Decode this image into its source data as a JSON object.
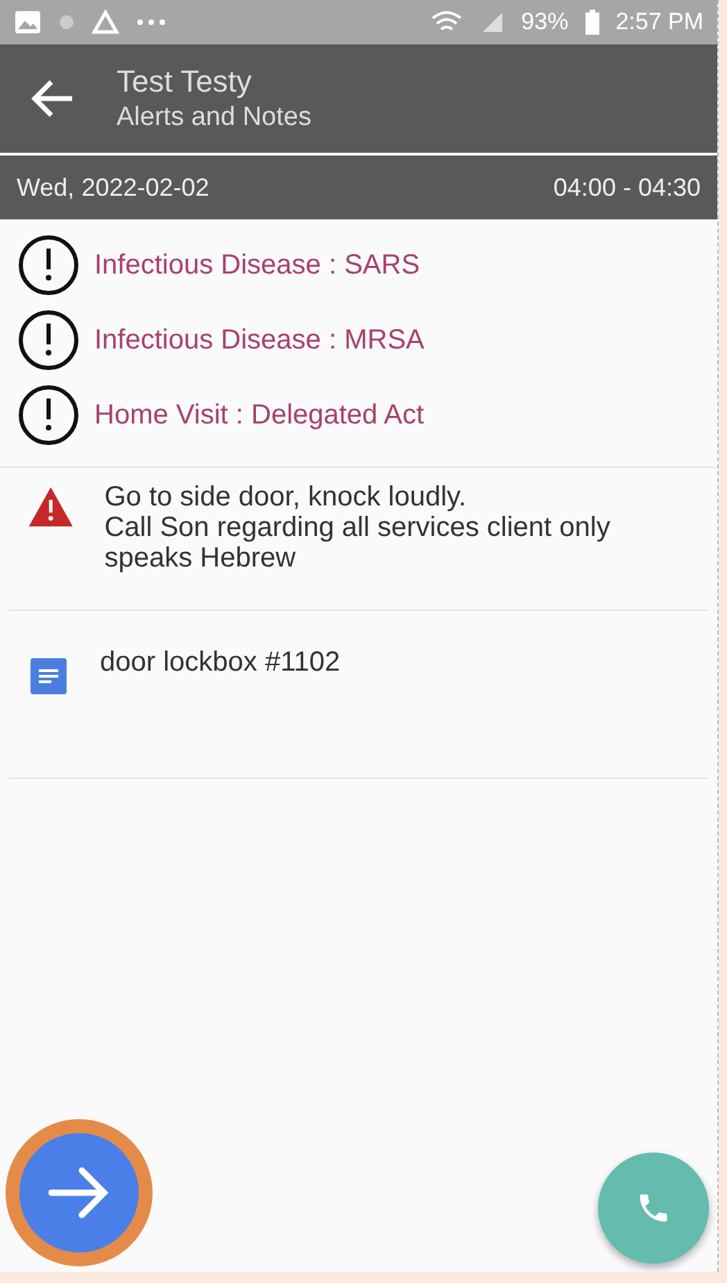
{
  "status_bar": {
    "battery": "93%",
    "time": "2:57 PM"
  },
  "header": {
    "title": "Test Testy",
    "subtitle": "Alerts and Notes"
  },
  "visit": {
    "date": "Wed, 2022-02-02",
    "time": "04:00 - 04:30"
  },
  "alerts": [
    {
      "text": "Infectious Disease : SARS"
    },
    {
      "text": "Infectious Disease : MRSA"
    },
    {
      "text": "Home Visit : Delegated Act"
    }
  ],
  "notes": [
    {
      "kind": "warning",
      "lines": [
        "Go to side door, knock loudly.",
        "Call Son regarding all services client only speaks Hebrew"
      ]
    },
    {
      "kind": "document",
      "lines": [
        "door lockbox #1102"
      ]
    }
  ],
  "next_button": {
    "highlighted": true
  }
}
